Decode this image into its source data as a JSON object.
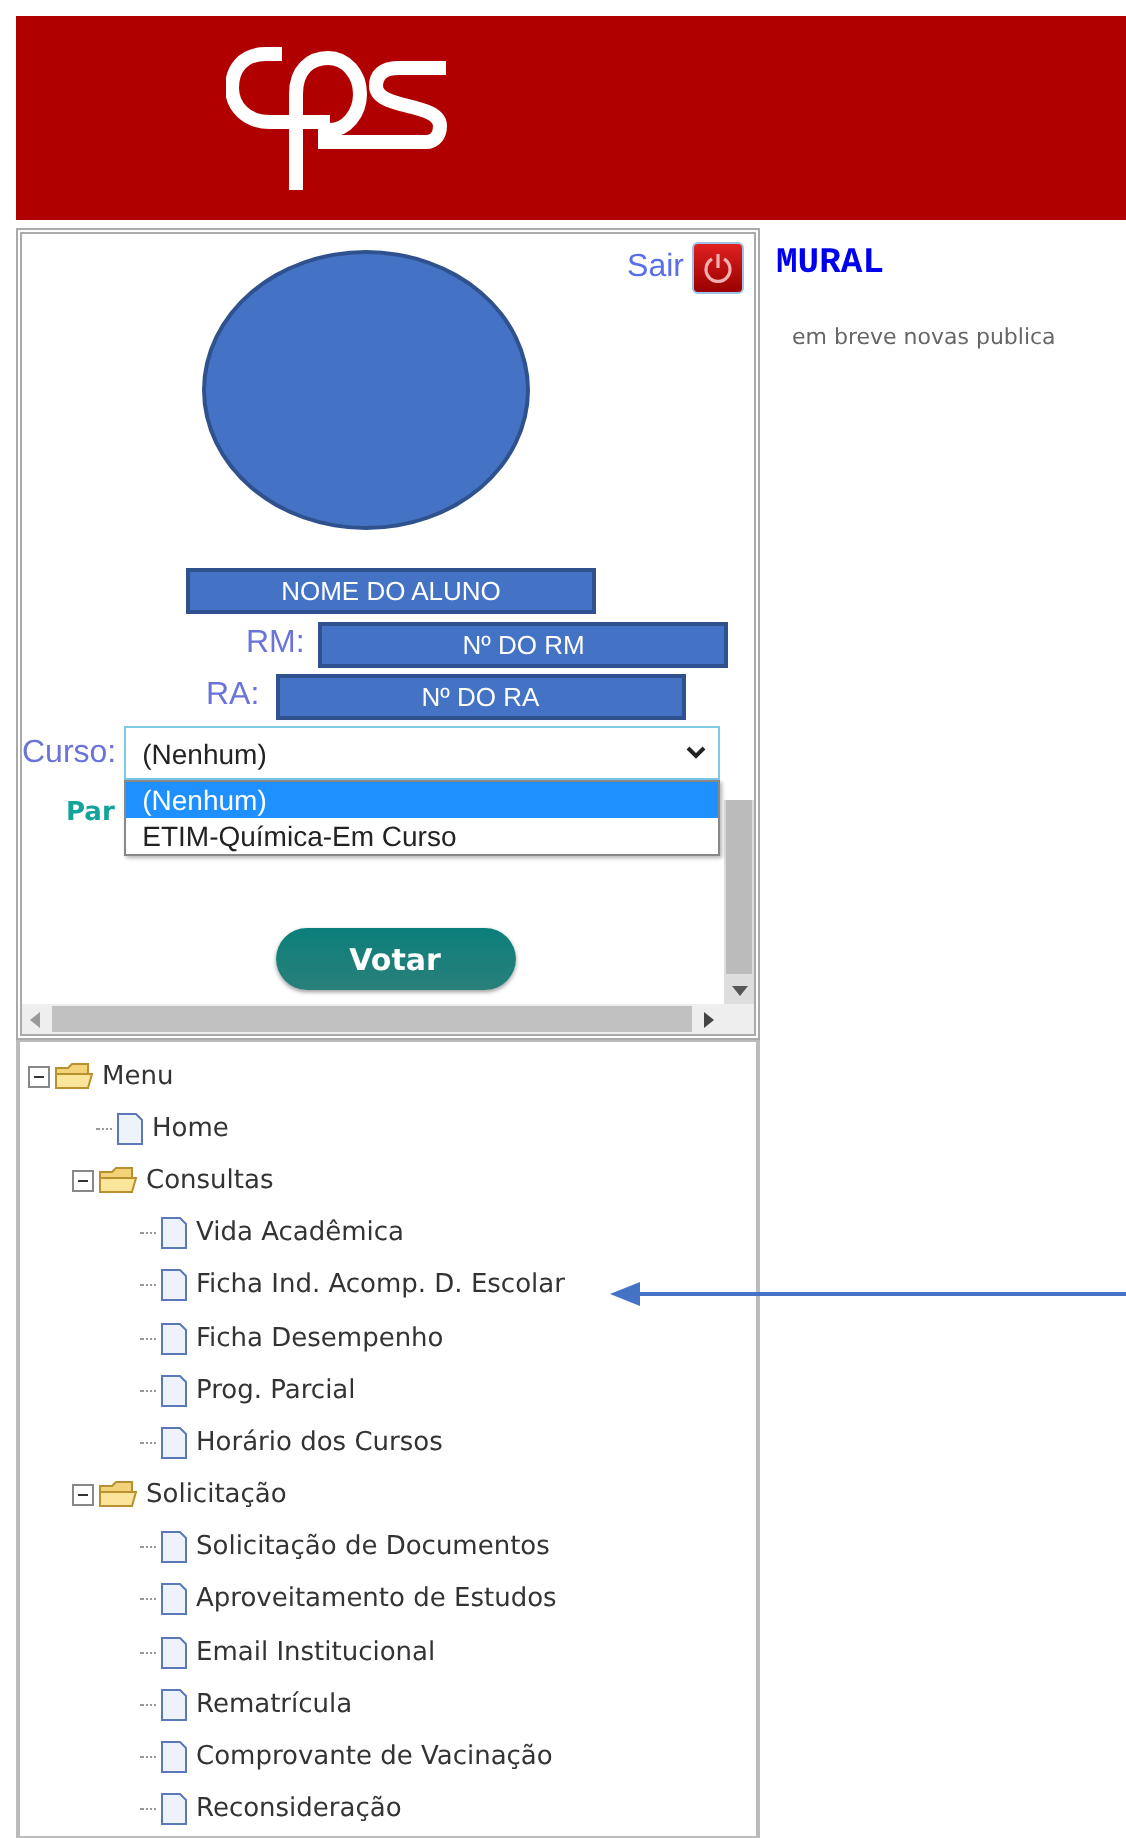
{
  "logout": {
    "label": "Sair"
  },
  "student": {
    "name": "NOME DO ALUNO",
    "rm_label": "RM:",
    "rm": "Nº DO RM",
    "ra_label": "RA:",
    "ra": "Nº DO RA"
  },
  "course": {
    "label": "Curso:",
    "value": "(Nenhum)",
    "expanded": true,
    "options": [
      {
        "label": "(Nenhum)",
        "selected": true
      },
      {
        "label": "ETIM-Química-Em Curso",
        "selected": false
      }
    ]
  },
  "partial_label": "Par",
  "vote_button": "Votar",
  "menu": {
    "label": "Menu",
    "kind": "folder",
    "expanded": true,
    "children": [
      {
        "label": "Home",
        "kind": "page"
      },
      {
        "label": "Consultas",
        "kind": "folder",
        "expanded": true,
        "children": [
          {
            "label": "Vida Acadêmica",
            "kind": "page"
          },
          {
            "label": "Ficha Ind. Acomp. D. Escolar",
            "kind": "page"
          },
          {
            "label": "Ficha Desempenho",
            "kind": "page"
          },
          {
            "label": "Prog. Parcial",
            "kind": "page"
          },
          {
            "label": "Horário dos Cursos",
            "kind": "page"
          }
        ]
      },
      {
        "label": "Solicitação",
        "kind": "folder",
        "expanded": true,
        "children": [
          {
            "label": "Solicitação de Documentos",
            "kind": "page"
          },
          {
            "label": "Aproveitamento de Estudos",
            "kind": "page"
          },
          {
            "label": "Email Institucional",
            "kind": "page"
          },
          {
            "label": "Rematrícula",
            "kind": "page"
          },
          {
            "label": "Comprovante de Vacinação",
            "kind": "page"
          },
          {
            "label": "Reconsideração",
            "kind": "page"
          }
        ]
      }
    ]
  },
  "mural": {
    "title": "MURAL",
    "message": "em breve novas publica"
  }
}
